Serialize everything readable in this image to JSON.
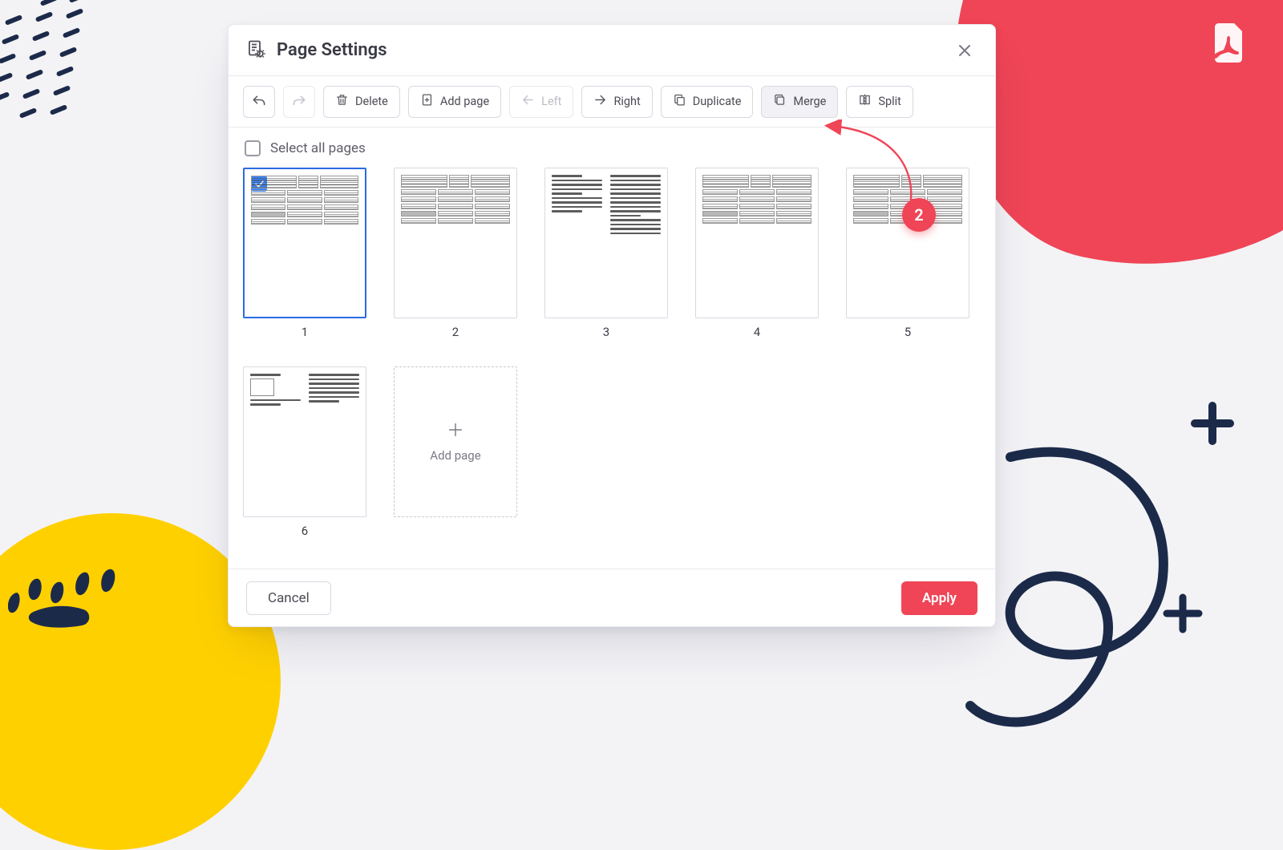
{
  "dialog": {
    "title": "Page Settings",
    "select_all_label": "Select all pages",
    "add_tile_label": "Add page"
  },
  "toolbar": {
    "undo": "Undo",
    "redo": "Redo",
    "delete": "Delete",
    "add_page": "Add page",
    "left": "Left",
    "right": "Right",
    "duplicate": "Duplicate",
    "merge": "Merge",
    "split": "Split"
  },
  "pages": {
    "p1": "1",
    "p2": "2",
    "p3": "3",
    "p4": "4",
    "p5": "5",
    "p6": "6"
  },
  "footer": {
    "cancel": "Cancel",
    "apply": "Apply"
  },
  "annotation": {
    "step": "2"
  }
}
